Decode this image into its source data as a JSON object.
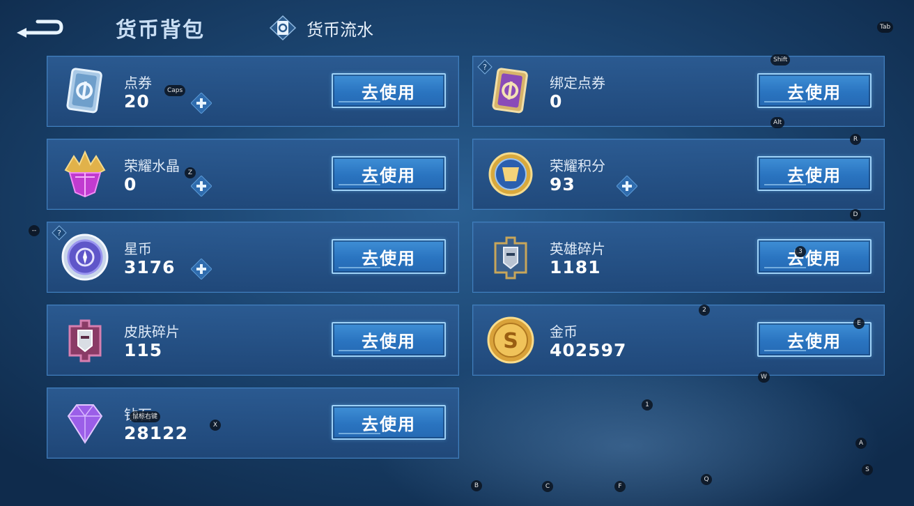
{
  "header": {
    "title": "货币背包",
    "tab_flow_label": "货币流水"
  },
  "cards": [
    {
      "name": "点券",
      "amount": "20",
      "button": "去使用"
    },
    {
      "name": "绑定点券",
      "amount": "0",
      "button": "去使用"
    },
    {
      "name": "荣耀水晶",
      "amount": "0",
      "button": "去使用"
    },
    {
      "name": "荣耀积分",
      "amount": "93",
      "button": "去使用"
    },
    {
      "name": "星币",
      "amount": "3176",
      "button": "去使用"
    },
    {
      "name": "英雄碎片",
      "amount": "1181",
      "button": "去使用"
    },
    {
      "name": "皮肤碎片",
      "amount": "115",
      "button": "去使用"
    },
    {
      "name": "金币",
      "amount": "402597",
      "button": "去使用"
    },
    {
      "name": "钻石",
      "amount": "28122",
      "button": "去使用"
    }
  ],
  "key_hints": {
    "tab": "Tab",
    "shift": "Shift",
    "caps": "Caps",
    "alt": "Alt",
    "r": "R",
    "z": "Z",
    "d": "D",
    "dash": "--",
    "three": "3",
    "two": "2",
    "e": "E",
    "w": "W",
    "one": "1",
    "mouse_right": "鼠标右键",
    "x": "X",
    "a": "A",
    "s": "S",
    "q": "Q",
    "b": "B",
    "c": "C",
    "f": "F"
  },
  "colors": {
    "button_fill": "#2a74c0",
    "button_border": "#9fd2f7",
    "card_border": "#3f7fbf"
  }
}
